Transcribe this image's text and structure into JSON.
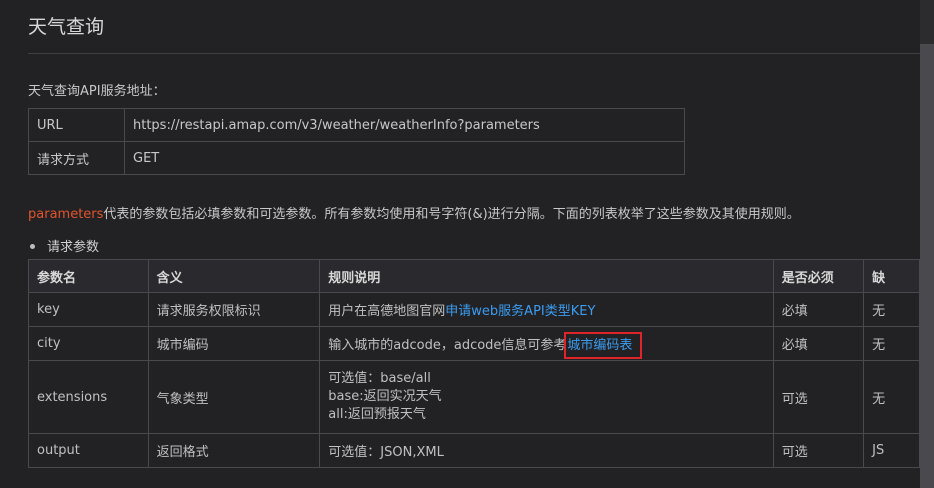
{
  "title": "天气查询",
  "intro": "天气查询API服务地址：",
  "url_table": [
    {
      "key": "URL",
      "value": "https://restapi.amap.com/v3/weather/weatherInfo?parameters"
    },
    {
      "key": "请求方式",
      "value": "GET"
    }
  ],
  "desc": {
    "highlight": "parameters",
    "text": "代表的参数包括必填参数和可选参数。所有参数均使用和号字符(&)进行分隔。下面的列表枚举了这些参数及其使用规则。"
  },
  "bullet": "请求参数",
  "params": {
    "headers": [
      "参数名",
      "含义",
      "规则说明",
      "是否必须",
      "缺"
    ],
    "rows": [
      {
        "name": "key",
        "meaning": "请求服务权限标识",
        "rule_text": "用户在高德地图官网",
        "rule_link": "申请web服务API类型KEY",
        "required": "必填",
        "default": "无"
      },
      {
        "name": "city",
        "meaning": "城市编码",
        "rule_text": "输入城市的adcode，adcode信息可参考",
        "rule_link": "城市编码表",
        "required": "必填",
        "default": "无"
      },
      {
        "name": "extensions",
        "meaning": "气象类型",
        "rule_lines": [
          "可选值：base/all",
          "base:返回实况天气",
          "all:返回预报天气"
        ],
        "required": "可选",
        "default": "无"
      },
      {
        "name": "output",
        "meaning": "返回格式",
        "rule_text": "可选值：JSON,XML",
        "required": "可选",
        "default": "JS"
      }
    ]
  },
  "colors": {
    "background": "#222225",
    "link": "#3b9cf0",
    "highlight_text": "#e2542c",
    "annotation_box": "#e0252a"
  }
}
